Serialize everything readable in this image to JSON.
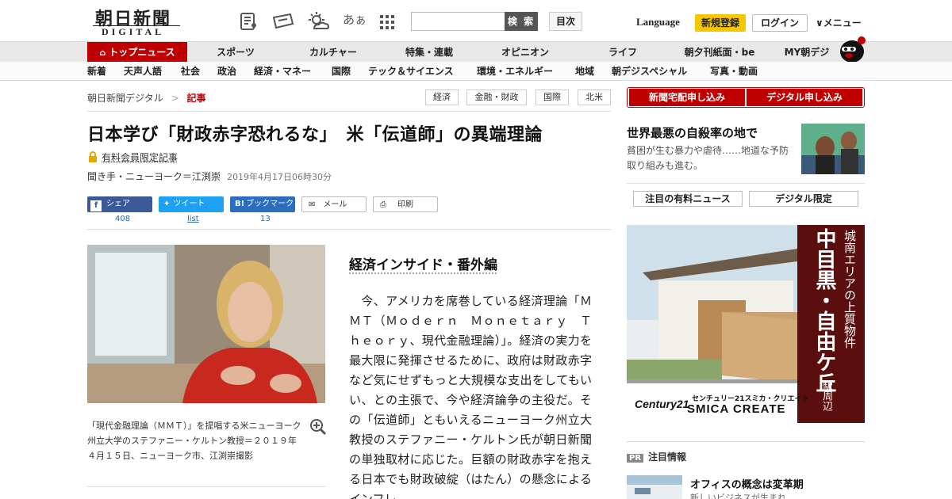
{
  "header": {
    "logo_jp": "朝日新聞",
    "logo_en": "DIGITAL",
    "font_size_glyph": "あぁ",
    "search_placeholder": "",
    "search_label": "検 索",
    "mokuji_label": "目次",
    "language_label": "Language",
    "register_label": "新規登録",
    "login_label": "ログイン",
    "menu_label": "メニュー"
  },
  "nav": {
    "main": [
      "トップニュース",
      "スポーツ",
      "カルチャー",
      "特集・連載",
      "オピニオン",
      "ライフ",
      "朝夕刊紙面・be",
      "MY朝デジ"
    ],
    "sub": [
      "新着",
      "天声人語",
      "社会",
      "政治",
      "経済・マネー",
      "国際",
      "テック＆サイエンス",
      "環境・エネルギー",
      "地域",
      "朝デジスペシャル",
      "写真・動画"
    ]
  },
  "breadcrumb": {
    "home": "朝日新聞デジタル",
    "sep": ">",
    "current": "記事"
  },
  "tags": [
    "経済",
    "金融・財政",
    "国際",
    "北米"
  ],
  "article": {
    "title": "日本学び「財政赤字恐れるな」　米「伝道師」の異端理論",
    "member_label": "有料会員限定記事",
    "byline": "聞き手・ニューヨーク＝江渕崇",
    "date": "2019年4月17日06時30分",
    "share": [
      {
        "label": "シェア",
        "count": "408"
      },
      {
        "label": "ツイート",
        "count": "list"
      },
      {
        "label": "ブックマーク",
        "count": "13"
      },
      {
        "label": "メール",
        "count": ""
      },
      {
        "label": "印刷",
        "count": ""
      }
    ],
    "caption": "「現代金融理論（ＭＭＴ）」を提唱する米ニューヨーク州立大学のステファニー・ケルトン教授＝２０１９年４月１５日、ニューヨーク市、江渕崇撮影",
    "section_heading": "経済インサイド・番外編",
    "body": "　今、アメリカを席巻している経済理論「ＭＭＴ（Ｍｏｄｅｒｎ　Ｍｏｎｅｔａｒｙ　Ｔｈｅｏｒｙ、現代金融理論）」。経済の実力を最大限に発揮させるために、政府は財政赤字など気にせずもっと大規模な支出をしてもいい、との主張で、今や経済論争の主役だ。その「伝道師」ともいえるニューヨーク州立大教授のステファニー・ケルトン氏が朝日新聞の単独取材に応じた。巨額の財政赤字を抱える日本でも財政破綻（はたん）の懸念による インフレ"
  },
  "sidebar": {
    "btn_delivery": "新聞宅配申し込み",
    "btn_digital": "デジタル申し込み",
    "feature_title": "世界最悪の自殺率の地で",
    "feature_desc": "貧困が生む暴力や虐待……地道な予防取り組みも進む。",
    "tab_paid": "注目の有料ニュース",
    "tab_digital": "デジタル限定",
    "ad_vertical": "城南エリアの上質物件",
    "ad_main": "中目黒・自由ケ丘",
    "ad_station": "駅周辺",
    "ad_brand": "Century21",
    "ad_company_jp": "センチュリー21スミカ・クリエイト",
    "ad_company_en": "SMICA CREATE",
    "pr_badge": "PR",
    "pr_label": "注目情報",
    "pr_title": "オフィスの概念は変革期",
    "pr_sub": "新しいビジネスが生まれ"
  },
  "colors": {
    "brand_red": "#c00000",
    "register_yellow": "#f6c700",
    "facebook": "#3b5998",
    "twitter": "#1da1f2",
    "hatena": "#2c6ebd"
  }
}
